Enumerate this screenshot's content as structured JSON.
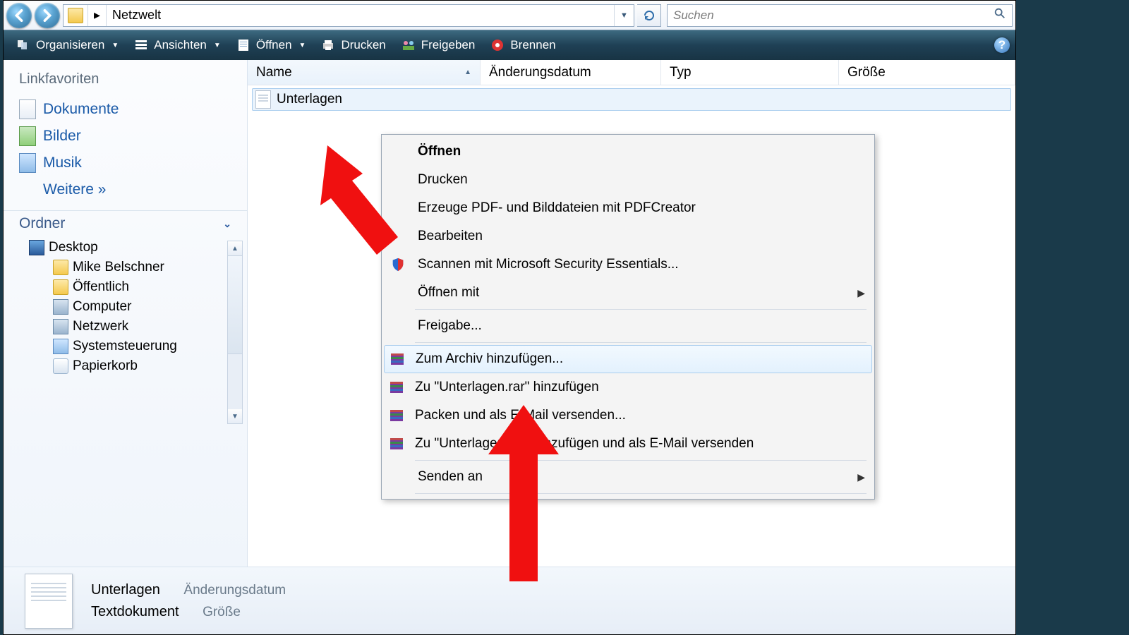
{
  "address": {
    "folder": "Netzwelt",
    "arrow": "▸"
  },
  "search": {
    "placeholder": "Suchen"
  },
  "toolbar": {
    "organize": "Organisieren",
    "views": "Ansichten",
    "open": "Öffnen",
    "print": "Drucken",
    "share": "Freigeben",
    "burn": "Brennen"
  },
  "sidebar": {
    "favorites_hdr": "Linkfavoriten",
    "links": {
      "documents": "Dokumente",
      "pictures": "Bilder",
      "music": "Musik",
      "more": "Weitere  »"
    },
    "folders_hdr": "Ordner",
    "tree": {
      "desktop": "Desktop",
      "user": "Mike Belschner",
      "public": "Öffentlich",
      "computer": "Computer",
      "network": "Netzwerk",
      "control": "Systemsteuerung",
      "bin": "Papierkorb"
    }
  },
  "columns": {
    "name": "Name",
    "modified": "Änderungsdatum",
    "type": "Typ",
    "size": "Größe"
  },
  "file": {
    "name": "Unterlagen"
  },
  "details": {
    "name": "Unterlagen",
    "type": "Textdokument",
    "mod_label": "Änderungsdatum",
    "size_label": "Größe"
  },
  "ctx": {
    "open": "Öffnen",
    "print": "Drucken",
    "pdf": "Erzeuge PDF- und Bilddateien mit PDFCreator",
    "edit": "Bearbeiten",
    "scan": "Scannen mit Microsoft Security Essentials...",
    "openwith": "Öffnen mit",
    "share": "Freigabe...",
    "addarchive": "Zum Archiv hinzufügen...",
    "addrar": "Zu \"Unterlagen.rar\" hinzufügen",
    "packmail": "Packen und als E-Mail versenden...",
    "addrarmail": "Zu \"Unterlagen.rar\" hinzufügen und als E-Mail versenden",
    "sendto": "Senden an"
  }
}
